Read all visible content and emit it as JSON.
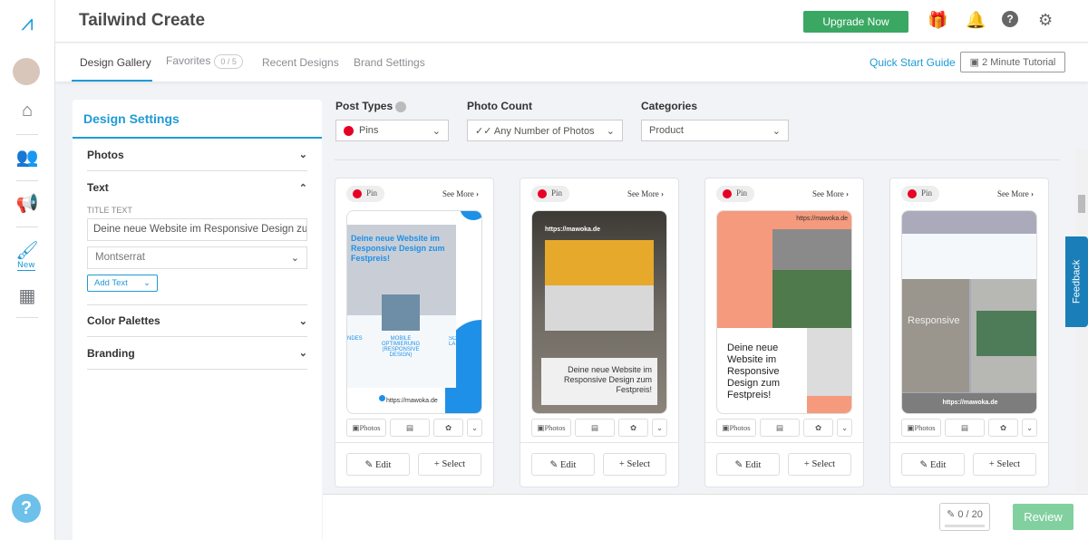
{
  "app": {
    "title": "Tailwind Create",
    "upgrade": "Upgrade Now"
  },
  "rail": {
    "new_label": "New"
  },
  "tabs": [
    {
      "label": "Design Gallery"
    },
    {
      "label": "Favorites",
      "badge": "0 / 5"
    },
    {
      "label": "Recent Designs"
    },
    {
      "label": "Brand Settings"
    }
  ],
  "links": {
    "quick_start": "Quick Start Guide",
    "tutorial": "2 Minute Tutorial"
  },
  "settings": {
    "title": "Design Settings",
    "photos": "Photos",
    "text": "Text",
    "title_text_label": "TITLE TEXT",
    "title_text_value": "Deine neue Website im Responsive Design zum Festpreis!",
    "font": "Montserrat",
    "add_text": "Add Text",
    "color_palettes": "Color Palettes",
    "branding": "Branding"
  },
  "filters": {
    "post_types_label": "Post Types",
    "post_types_value": "Pins",
    "photo_count_label": "Photo Count",
    "photo_count_value": "Any Number of Photos",
    "categories_label": "Categories",
    "categories_value": "Product"
  },
  "card": {
    "pin": "Pin",
    "see_more": "See More",
    "photos": "Photos",
    "edit": "Edit",
    "select": "Select"
  },
  "pins": [
    {
      "headline": "Deine neue Website im Responsive Design zum Festpreis!",
      "features": [
        "NDES",
        "MOBILE OPTIMIERUNG (RESPONSIVE DESIGN)",
        "SC LA"
      ],
      "url": "https://mawoka.de",
      "accent": "#1e90e8"
    },
    {
      "headline": "Deine neue Website im Responsive Design zum Festpreis!",
      "url": "https://mawoka.de"
    },
    {
      "headline": "Deine neue Website im Responsive Design zum Festpreis!",
      "url": "https://mawoka.de",
      "accent": "#f59a7c"
    },
    {
      "overlay": "Responsive",
      "url": "https://mawoka.de"
    }
  ],
  "footer": {
    "counter": "0 / 20",
    "review": "Review"
  },
  "feedback": "Feedback"
}
